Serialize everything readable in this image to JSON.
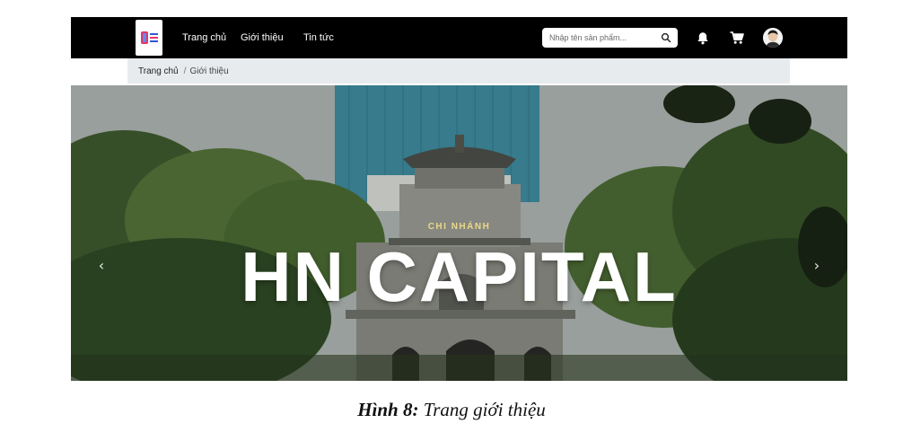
{
  "navbar": {
    "logo_alt": "logo",
    "links": [
      "Trang chủ",
      "Giới thiệu",
      "Tin tức"
    ],
    "search": {
      "placeholder": "Nhập tên sản phẩm..."
    },
    "icons": [
      "search-icon",
      "bell-icon",
      "cart-icon",
      "avatar"
    ]
  },
  "breadcrumb": {
    "home": "Trang chủ",
    "separator": "/",
    "current": "Giới thiệu"
  },
  "hero": {
    "subtitle": "CHI NHÁNH",
    "headline": "HN CAPITAL",
    "prev_icon": "chevron-left-icon",
    "next_icon": "chevron-right-icon"
  },
  "caption": {
    "label": "Hình 8:",
    "text": "Trang giới thiệu"
  },
  "colors": {
    "navbar_bg": "#000000",
    "breadcrumb_bg": "#e8ebed",
    "subtitle": "#e9d98a",
    "headline": "#ffffff"
  }
}
